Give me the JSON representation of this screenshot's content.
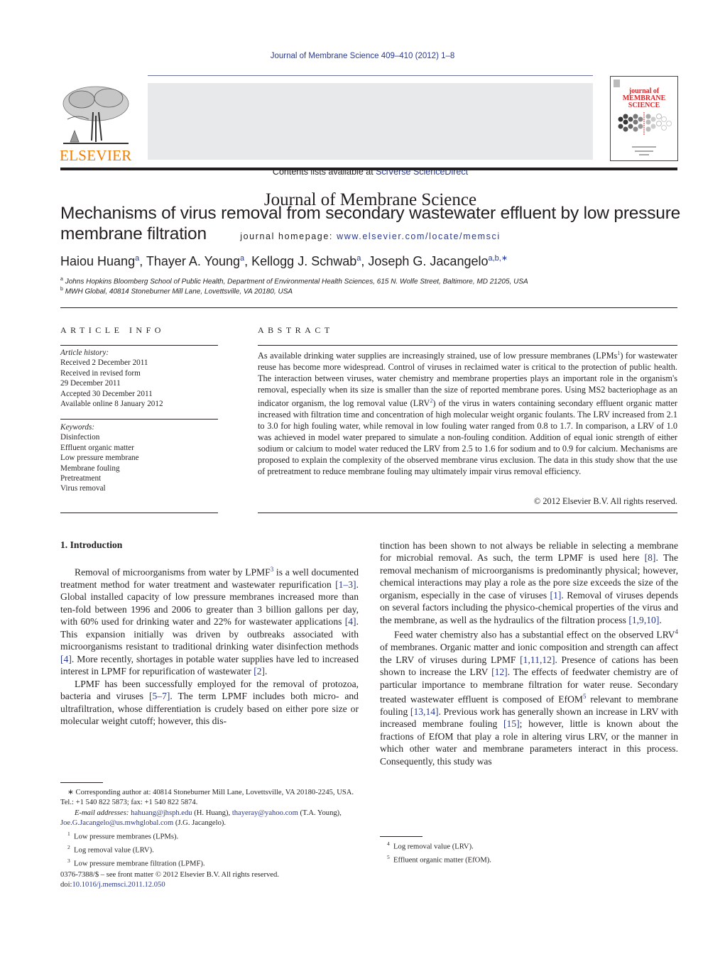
{
  "header": {
    "journal_ref": "Journal of Membrane Science 409–410 (2012) 1–8",
    "contents_prefix": "Contents lists available at ",
    "contents_link": "SciVerse ScienceDirect",
    "journal_title": "Journal of Membrane Science",
    "homepage_prefix": "journal homepage: ",
    "homepage_link": "www.elsevier.com/locate/memsci",
    "publisher_logo_text": "ELSEVIER",
    "cover": {
      "line1": "journal of",
      "line2": "MEMBRANE",
      "line3": "SCIENCE"
    },
    "colors": {
      "publisher_orange": "#f07d00",
      "link_blue": "#2a3a8c",
      "cover_red": "#d8262a",
      "banner_gray": "#e8e9ea"
    }
  },
  "article": {
    "title": "Mechanisms of virus removal from secondary wastewater effluent by low pressure membrane filtration",
    "authors": [
      {
        "name": "Haiou Huang",
        "aff": "a"
      },
      {
        "name": "Thayer A. Young",
        "aff": "a"
      },
      {
        "name": "Kellogg J. Schwab",
        "aff": "a"
      },
      {
        "name": "Joseph G. Jacangelo",
        "aff": "a,b,∗"
      }
    ],
    "affiliations": [
      {
        "key": "a",
        "text": "Johns Hopkins Bloomberg School of Public Health, Department of Environmental Health Sciences, 615 N. Wolfe Street, Baltimore, MD 21205, USA"
      },
      {
        "key": "b",
        "text": "MWH Global, 40814 Stoneburner Mill Lane, Lovettsville, VA 20180, USA"
      }
    ]
  },
  "article_info": {
    "label": "ARTICLE INFO",
    "history_heading": "Article history:",
    "history": [
      "Received 2 December 2011",
      "Received in revised form",
      "29 December 2011",
      "Accepted 30 December 2011",
      "Available online 8 January 2012"
    ],
    "keywords_heading": "Keywords:",
    "keywords": [
      "Disinfection",
      "Effluent organic matter",
      "Low pressure membrane",
      "Membrane fouling",
      "Pretreatment",
      "Virus removal"
    ]
  },
  "abstract": {
    "label": "ABSTRACT",
    "part1": "As available drinking water supplies are increasingly strained, use of low pressure membranes (LPMs",
    "sup1": "1",
    "part2": ") for wastewater reuse has become more widespread. Control of viruses in reclaimed water is critical to the protection of public health. The interaction between viruses, water chemistry and membrane properties plays an important role in the organism's removal, especially when its size is smaller than the size of reported membrane pores. Using MS2 bacteriophage as an indicator organism, the log removal value (LRV",
    "sup2": "2",
    "part3": ") of the virus in waters containing secondary effluent organic matter increased with filtration time and concentration of high molecular weight organic foulants. The LRV increased from 2.1 to 3.0 for high fouling water, while removal in low fouling water ranged from 0.8 to 1.7. In comparison, a LRV of 1.0 was achieved in model water prepared to simulate a non-fouling condition. Addition of equal ionic strength of either sodium or calcium to model water reduced the LRV from 2.5 to 1.6 for sodium and to 0.9 for calcium. Mechanisms are proposed to explain the complexity of the observed membrane virus exclusion. The data in this study show that the use of pretreatment to reduce membrane fouling may ultimately impair virus removal efficiency.",
    "copyright": "© 2012 Elsevier B.V. All rights reserved."
  },
  "intro": {
    "heading": "1.  Introduction",
    "p1": [
      "Removal of microorganisms from water by LPMF",
      "3",
      " is a well documented treatment method for water treatment and wastewater repurification ",
      "[1–3]",
      ". Global installed capacity of low pressure membranes increased more than ten-fold between 1996 and 2006 to greater than 3 billion gallons per day, with 60% used for drinking water and 22% for wastewater applications ",
      "[4]",
      ". This expansion initially was driven by outbreaks associated with microorganisms resistant to traditional drinking water disinfection methods ",
      "[4]",
      ". More recently, shortages in potable water supplies have led to increased interest in LPMF for repurification of wastewater ",
      "[2]",
      "."
    ],
    "p2": [
      "LPMF has been successfully employed for the removal of protozoa, bacteria and viruses ",
      "[5–7]",
      ". The term LPMF includes both micro- and ultrafiltration, whose differentiation is crudely based on either pore size or molecular weight cutoff; however, this dis-"
    ],
    "p2_cont": [
      "tinction has been shown to not always be reliable in selecting a membrane for microbial removal. As such, the term LPMF is used here ",
      "[8]",
      ". The removal mechanism of microorganisms is predominantly physical; however, chemical interactions may play a role as the pore size exceeds the size of the organism, especially in the case of viruses ",
      "[1]",
      ". Removal of viruses depends on several factors including the physico-chemical properties of the virus and the membrane, as well as the hydraulics of the filtration process ",
      "[1,9,10]",
      "."
    ],
    "p3": [
      "Feed water chemistry also has a substantial effect on the observed LRV",
      "4",
      " of membranes. Organic matter and ionic composition and strength can affect the LRV of viruses during LPMF ",
      "[1,11,12]",
      ". Presence of cations has been shown to increase the LRV ",
      "[12]",
      ". The effects of feedwater chemistry are of particular importance to membrane filtration for water reuse. Secondary treated wastewater effluent is composed of EfOM",
      "5",
      " relevant to membrane fouling ",
      "[13,14]",
      ". Previous work has generally shown an increase in LRV with increased membrane fouling ",
      "[15]",
      "; however, little is known about the fractions of EfOM that play a role in altering virus LRV, or the manner in which other water and membrane parameters interact in this process. Consequently, this study was"
    ]
  },
  "footnotes_left": {
    "corresponding": "∗ Corresponding author at: 40814 Stoneburner Mill Lane, Lovettsville, VA 20180-2245, USA. Tel.: +1 540 822 5873; fax: +1 540 822 5874.",
    "email_label": "E-mail addresses: ",
    "email1": "hahuang@jhsph.edu",
    "email1_who": " (H. Huang), ",
    "email2": "thayeray@yahoo.com",
    "email2_who": " (T.A. Young), ",
    "email3": "Joe.G.Jacangelo@us.mwhglobal.com",
    "email3_who": " (J.G. Jacangelo).",
    "notes": [
      {
        "n": "1",
        "text": "Low pressure membranes (LPMs)."
      },
      {
        "n": "2",
        "text": "Log removal value (LRV)."
      },
      {
        "n": "3",
        "text": "Low pressure membrane filtration (LPMF)."
      }
    ]
  },
  "footnotes_right": {
    "notes": [
      {
        "n": "4",
        "text": "Log removal value (LRV)."
      },
      {
        "n": "5",
        "text": "Effluent organic matter (EfOM)."
      }
    ]
  },
  "footer": {
    "issn_line": "0376-7388/$ – see front matter © 2012 Elsevier B.V. All rights reserved.",
    "doi_prefix": "doi:",
    "doi": "10.1016/j.memsci.2011.12.050"
  }
}
